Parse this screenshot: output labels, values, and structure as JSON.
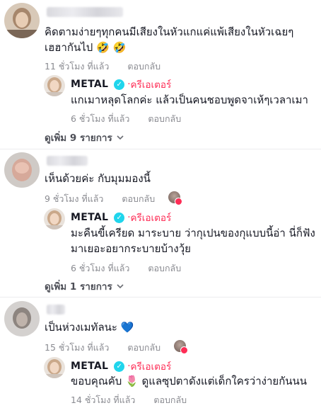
{
  "comments": [
    {
      "text_line1": "คิดตามง่ายๆทุกคนมีเสียงในหัวแกแค่แพ้เสียงในหัวเฉยๆ",
      "text_line2": "เฮฮากันไป 🤣 🤣",
      "time": "11 ชั่วโมง ที่แล้ว",
      "reply_label": "ตอบกลับ",
      "reply": {
        "name": "METAL",
        "creator_label": "ครีเอเตอร์",
        "creator_dot": "·",
        "text_line1": "แกเมาหลุดโลกค่ะ แล้วเป็นคนชอบพูดจาเห้ๆเวลาเมา",
        "time": "6 ชั่วโมง ที่แล้ว",
        "reply_label": "ตอบกลับ"
      },
      "view_more": "ดูเพิ่ม 9 รายการ"
    },
    {
      "text_line1": "เห็นด้วยค่ะ กับมุมมองนี้",
      "time": "9 ชั่วโมง ที่แล้ว",
      "reply_label": "ตอบกลับ",
      "reply": {
        "name": "METAL",
        "creator_label": "ครีเอเตอร์",
        "creator_dot": "·",
        "text_line1": "มะคืนขี้เครียด มาระบาย ว่ากุเปนของกุแบบนี้อ่า นี่ก็ฟัง",
        "text_line2": "มาเยอะอยากระบายบ้างวุ้ย",
        "time": "6 ชั่วโมง ที่แล้ว",
        "reply_label": "ตอบกลับ"
      },
      "view_more": "ดูเพิ่ม 1 รายการ"
    },
    {
      "text_line1": "เป็นห่วงเมทัลนะ 💙",
      "time": "15 ชั่วโมง ที่แล้ว",
      "reply_label": "ตอบกลับ",
      "reply": {
        "name": "METAL",
        "creator_label": "ครีเอเตอร์",
        "creator_dot": "·",
        "text_line1": "ขอบคุณคับ 🌷 ดูแลซุปตาดังแต่เด็กใครว่าง่ายกันนน",
        "time": "14 ชั่วโมง ที่แล้ว",
        "reply_label": "ตอบกลับ"
      }
    }
  ],
  "icons": {
    "verified": "✓",
    "chevron_down": "⌄"
  },
  "colors": {
    "creator_accent": "#fe2c55",
    "verified_badge": "#20d5ec",
    "meta_text": "#8a8b91"
  }
}
